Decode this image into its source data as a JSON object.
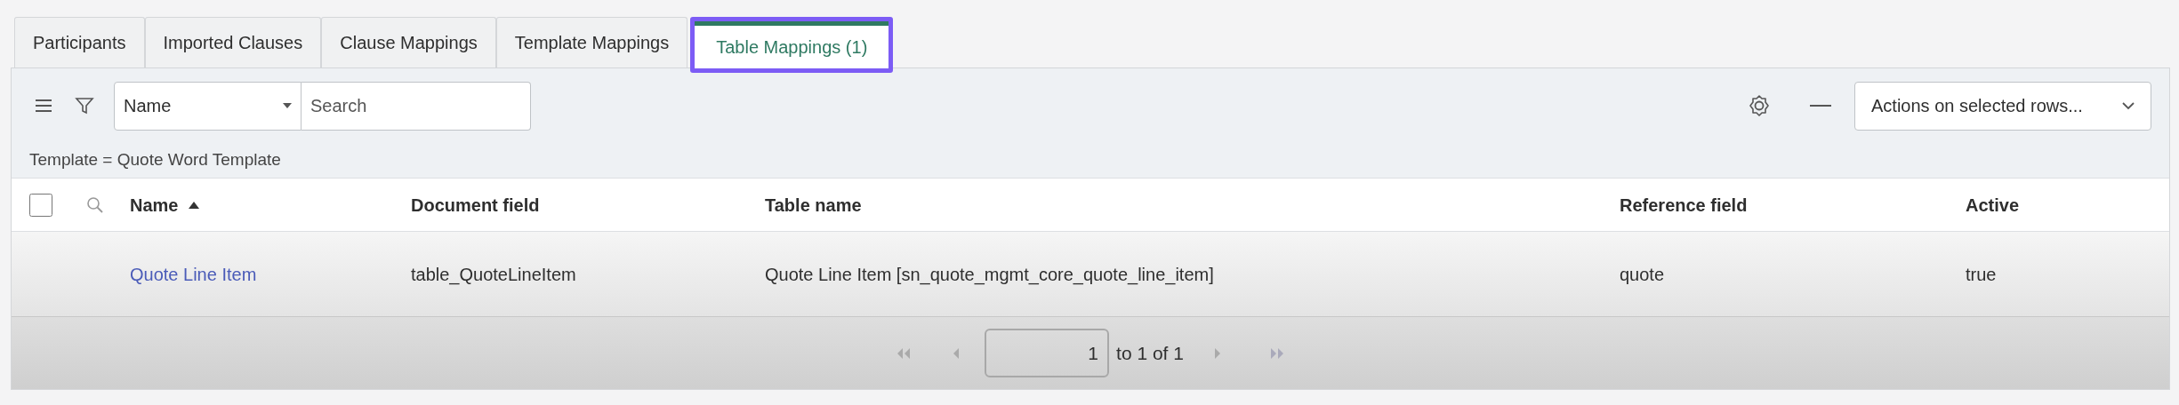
{
  "tabs": [
    {
      "label": "Participants",
      "selected": false
    },
    {
      "label": "Imported Clauses",
      "selected": false
    },
    {
      "label": "Clause Mappings",
      "selected": false
    },
    {
      "label": "Template Mappings",
      "selected": false
    },
    {
      "label": "Table Mappings (1)",
      "selected": true
    }
  ],
  "toolbar": {
    "search_field_select": "Name",
    "search": {
      "placeholder": "Search"
    },
    "actions_select": "Actions on selected rows..."
  },
  "breadcrumb": "Template = Quote Word Template",
  "table": {
    "select_all": {
      "checked": false
    },
    "columns": [
      {
        "label": "Name",
        "sorted": true
      },
      {
        "label": "Document field",
        "sorted": false
      },
      {
        "label": "Table name",
        "sorted": false
      },
      {
        "label": "Reference field",
        "sorted": false
      },
      {
        "label": "Active",
        "sorted": false
      }
    ],
    "rows": [
      {
        "cells": [
          "Quote Line Item",
          "table_QuoteLineItem",
          "Quote Line Item [sn_quote_mgmt_core_quote_line_item]",
          "quote",
          "true"
        ]
      }
    ]
  },
  "pagination": {
    "page": "1",
    "range": "to 1 of 1"
  }
}
